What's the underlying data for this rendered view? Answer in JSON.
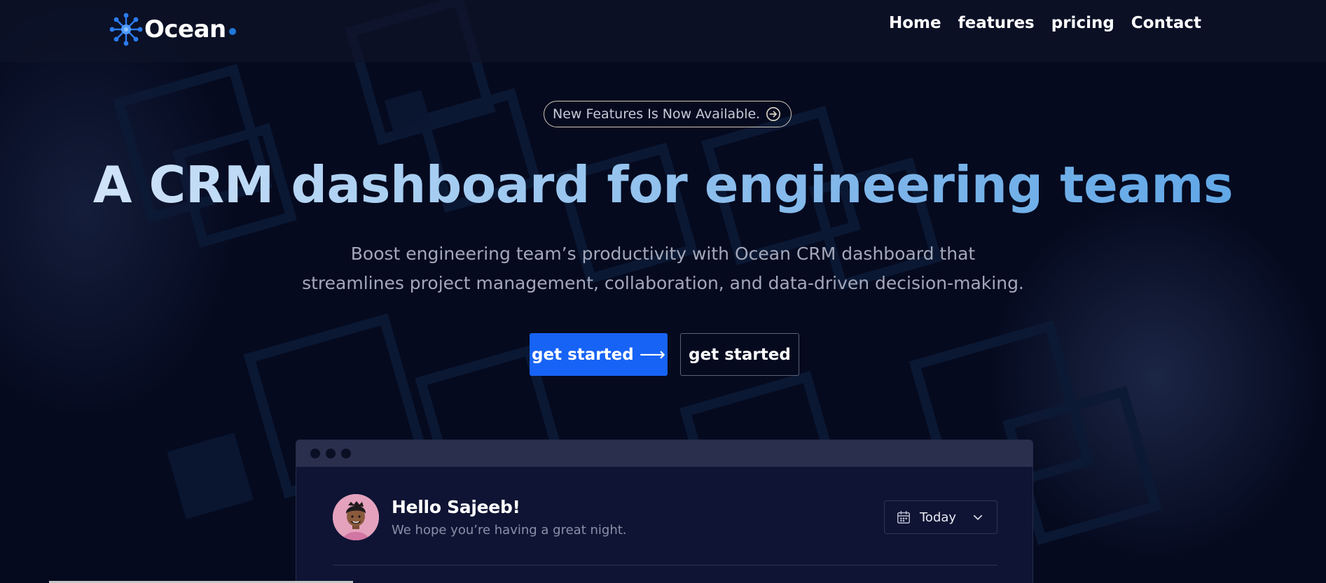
{
  "header": {
    "logo_text": "Ocean",
    "nav": [
      "Home",
      "features",
      "pricing",
      "Contact"
    ]
  },
  "hero": {
    "badge_text": "New Features Is Now Available.",
    "headline": "A CRM dashboard for engineering teams",
    "subtitle": "Boost engineering team’s productivity with Ocean CRM dashboard that streamlines project management, collaboration, and data-driven decision-making.",
    "primary_button": "get started",
    "primary_arrow": "⟶",
    "secondary_button": "get started"
  },
  "dashboard_preview": {
    "greeting": "Hello Sajeeb!",
    "greeting_sub": "We hope you’re having a great night.",
    "date_select": "Today"
  },
  "colors": {
    "background": "#050a1f",
    "primary_button": "#1763f5",
    "headline_gradient_start": "#dce9fa",
    "headline_gradient_end": "#5aa4e6",
    "logo_accent": "#2b7bf0"
  },
  "icons": [
    "ocean-logo-icon",
    "arrow-right-circle-icon",
    "calendar-icon",
    "chevron-down-icon",
    "avatar-image"
  ]
}
